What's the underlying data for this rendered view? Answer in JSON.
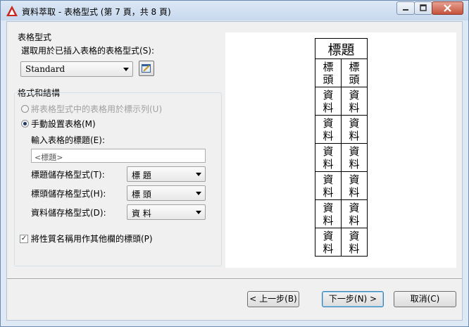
{
  "window": {
    "title": "資料萃取 - 表格型式 (第 7 頁，共 8 頁)"
  },
  "table_style": {
    "group_label": "表格型式",
    "prompt_label": "選取用於已插入表格的表格型式(S):",
    "selected_style": "Standard"
  },
  "format": {
    "group_label": "格式和結構",
    "option_label_rows": "將表格型式中的表格用於標示列(U)",
    "option_manual": "手動設置表格(M)",
    "title_prompt": "輸入表格的標題(E):",
    "title_placeholder": "<標題>",
    "title_cell_label": "標題儲存格型式(T):",
    "title_cell_value": "標 題",
    "header_cell_label": "標頭儲存格型式(H):",
    "header_cell_value": "標 頭",
    "data_cell_label": "資料儲存格型式(D):",
    "data_cell_value": "資 料",
    "use_property_names_label": "將性質名稱用作其他欄的標頭(P)",
    "use_property_names_checked": true
  },
  "preview": {
    "title": "標題",
    "header_cells": [
      "標\n頭",
      "標\n頭"
    ],
    "data_rows": [
      [
        "資\n料",
        "資\n料"
      ],
      [
        "資\n料",
        "資\n料"
      ],
      [
        "資\n料",
        "資\n料"
      ],
      [
        "資\n料",
        "資\n料"
      ],
      [
        "資\n料",
        "資\n料"
      ],
      [
        "資\n料",
        "資\n料"
      ]
    ]
  },
  "buttons": {
    "back": "< 上一步(B)",
    "next": "下一步(N) >",
    "cancel": "取消(C)"
  },
  "colors": {
    "app_icon": "#c8281e",
    "close_button": "#c5533c"
  }
}
